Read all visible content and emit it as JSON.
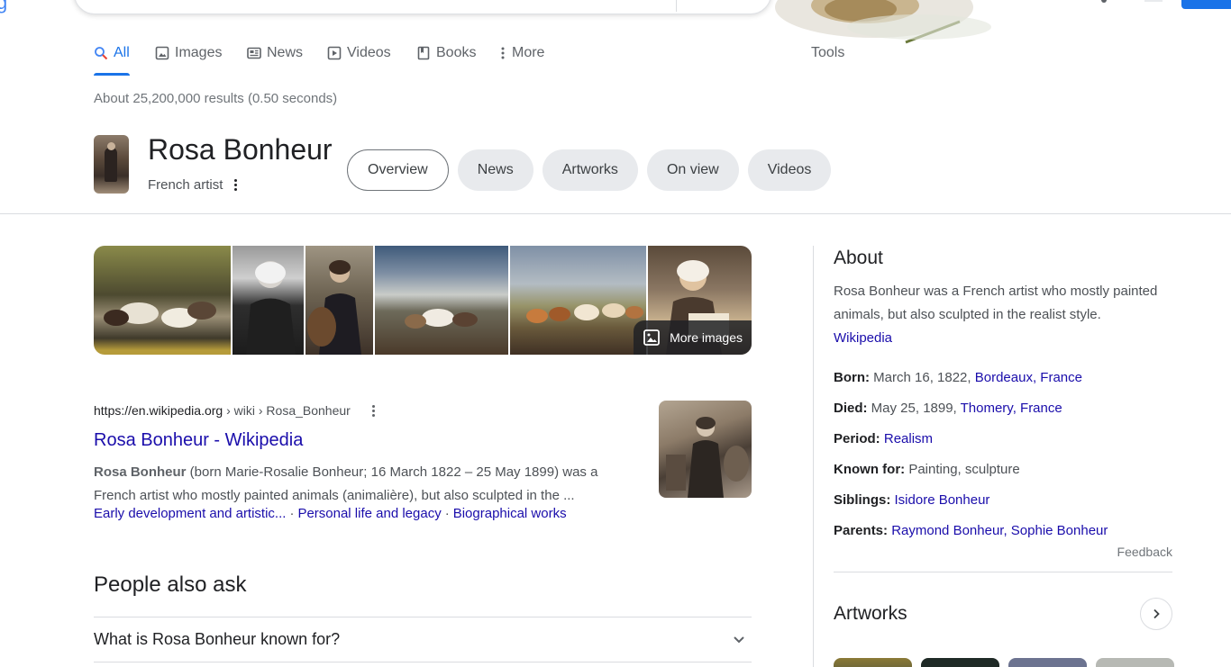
{
  "header": {
    "logo_fragment": "g"
  },
  "tabs": [
    {
      "label": "All",
      "icon": "search-icon",
      "active": true
    },
    {
      "label": "Images",
      "icon": "image-icon"
    },
    {
      "label": "News",
      "icon": "news-icon"
    },
    {
      "label": "Videos",
      "icon": "video-icon"
    },
    {
      "label": "Books",
      "icon": "book-icon"
    },
    {
      "label": "More",
      "icon": "more-vert-icon"
    }
  ],
  "tools_label": "Tools",
  "result_stats": "About 25,200,000 results (0.50 seconds)",
  "entity": {
    "title": "Rosa Bonheur",
    "subtitle": "French artist",
    "chips": [
      "Overview",
      "News",
      "Artworks",
      "On view",
      "Videos"
    ]
  },
  "image_strip": {
    "more_label": "More images"
  },
  "result": {
    "domain": "https://en.wikipedia.org",
    "breadcrumb": " › wiki › Rosa_Bonheur",
    "title": "Rosa Bonheur - Wikipedia",
    "snippet_bold": "Rosa Bonheur",
    "snippet_rest": " (born Marie-Rosalie Bonheur; 16 March 1822 – 25 May 1899) was a French artist who mostly painted animals (animalière), but also sculpted in the ...",
    "links": [
      "Early development and artistic...",
      "Personal life and legacy",
      "Biographical works"
    ],
    "separator": "·"
  },
  "paa": {
    "title": "People also ask",
    "questions": [
      "What is Rosa Bonheur known for?"
    ]
  },
  "knowledge_panel": {
    "about_title": "About",
    "description": "Rosa Bonheur was a French artist who mostly painted animals, but also sculpted in the realist style.",
    "source_link": "Wikipedia",
    "facts": {
      "born": {
        "key": "Born:",
        "text": " March 16, 1822, ",
        "link": "Bordeaux, France"
      },
      "died": {
        "key": "Died:",
        "text": " May 25, 1899, ",
        "link": "Thomery, France"
      },
      "period": {
        "key": "Period:",
        "text": " ",
        "link": "Realism"
      },
      "known_for": {
        "key": "Known for:",
        "text": " Painting, sculpture"
      },
      "siblings": {
        "key": "Siblings:",
        "text": " ",
        "link": "Isidore Bonheur"
      },
      "parents": {
        "key": "Parents:",
        "text": " ",
        "link": "Raymond Bonheur, Sophie Bonheur"
      }
    },
    "feedback": "Feedback",
    "artworks_title": "Artworks"
  },
  "colors": {
    "link": "#1a0dab",
    "accent": "#1a73e8",
    "muted": "#4d5156"
  }
}
